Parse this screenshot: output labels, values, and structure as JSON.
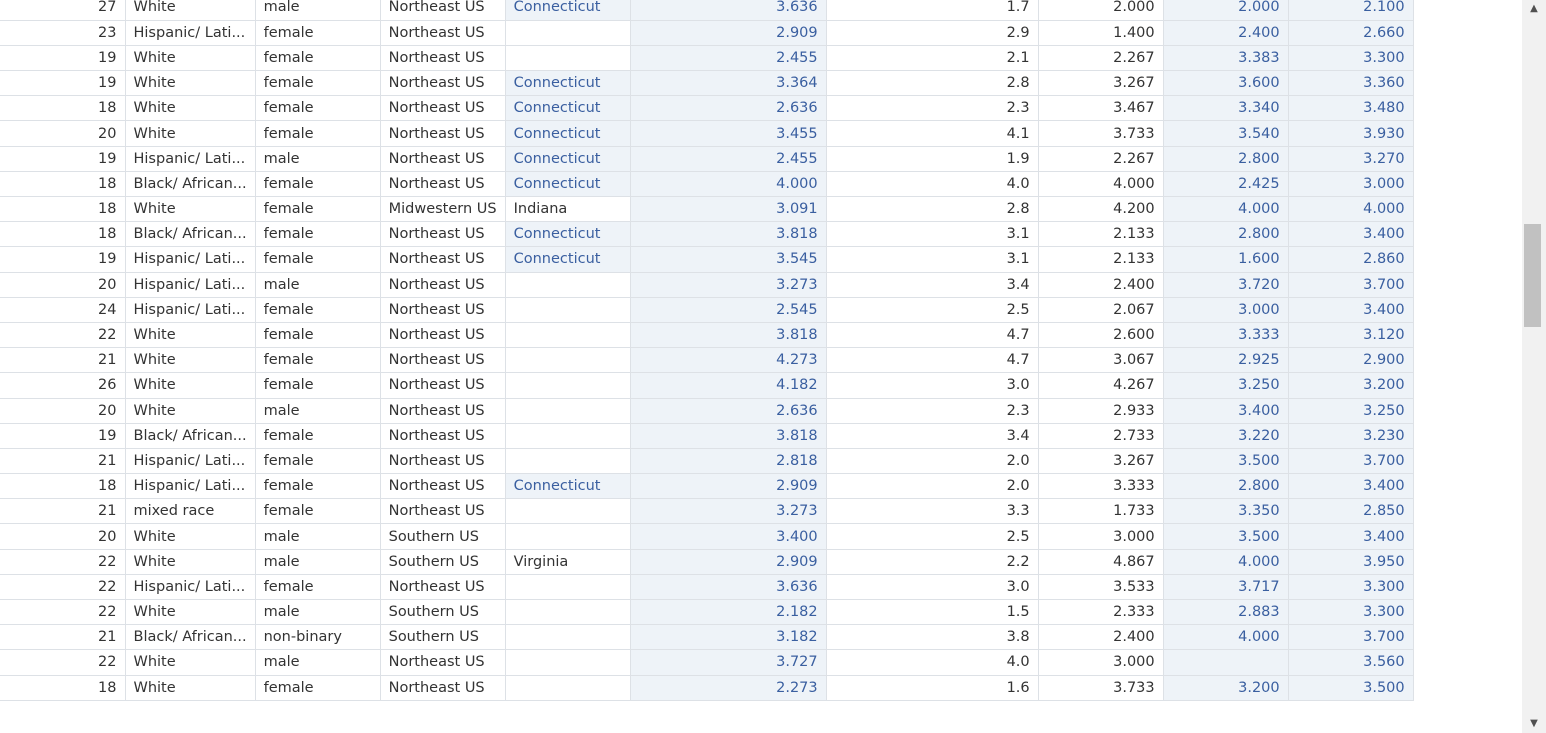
{
  "rows": [
    [
      "27",
      "White",
      "male",
      "Northeast US",
      "Connecticut",
      "3.636",
      "1.7",
      "2.000",
      "2.000",
      "2.100"
    ],
    [
      "23",
      "Hispanic/ Lati...",
      "female",
      "Northeast US",
      "",
      "2.909",
      "2.9",
      "1.400",
      "2.400",
      "2.660"
    ],
    [
      "19",
      "White",
      "female",
      "Northeast US",
      "",
      "2.455",
      "2.1",
      "2.267",
      "3.383",
      "3.300"
    ],
    [
      "19",
      "White",
      "female",
      "Northeast US",
      "Connecticut",
      "3.364",
      "2.8",
      "3.267",
      "3.600",
      "3.360"
    ],
    [
      "18",
      "White",
      "female",
      "Northeast US",
      "Connecticut",
      "2.636",
      "2.3",
      "3.467",
      "3.340",
      "3.480"
    ],
    [
      "20",
      "White",
      "female",
      "Northeast US",
      "Connecticut",
      "3.455",
      "4.1",
      "3.733",
      "3.540",
      "3.930"
    ],
    [
      "19",
      "Hispanic/ Lati...",
      "male",
      "Northeast US",
      "Connecticut",
      "2.455",
      "1.9",
      "2.267",
      "2.800",
      "3.270"
    ],
    [
      "18",
      "Black/ African...",
      "female",
      "Northeast US",
      "Connecticut",
      "4.000",
      "4.0",
      "4.000",
      "2.425",
      "3.000"
    ],
    [
      "18",
      "White",
      "female",
      "Midwestern US",
      "Indiana",
      "3.091",
      "2.8",
      "4.200",
      "4.000",
      "4.000"
    ],
    [
      "18",
      "Black/ African...",
      "female",
      "Northeast US",
      "Connecticut",
      "3.818",
      "3.1",
      "2.133",
      "2.800",
      "3.400"
    ],
    [
      "19",
      "Hispanic/ Lati...",
      "female",
      "Northeast US",
      "Connecticut",
      "3.545",
      "3.1",
      "2.133",
      "1.600",
      "2.860"
    ],
    [
      "20",
      "Hispanic/ Lati...",
      "male",
      "Northeast US",
      "",
      "3.273",
      "3.4",
      "2.400",
      "3.720",
      "3.700"
    ],
    [
      "24",
      "Hispanic/ Lati...",
      "female",
      "Northeast US",
      "",
      "2.545",
      "2.5",
      "2.067",
      "3.000",
      "3.400"
    ],
    [
      "22",
      "White",
      "female",
      "Northeast US",
      "",
      "3.818",
      "4.7",
      "2.600",
      "3.333",
      "3.120"
    ],
    [
      "21",
      "White",
      "female",
      "Northeast US",
      "",
      "4.273",
      "4.7",
      "3.067",
      "2.925",
      "2.900"
    ],
    [
      "26",
      "White",
      "female",
      "Northeast US",
      "",
      "4.182",
      "3.0",
      "4.267",
      "3.250",
      "3.200"
    ],
    [
      "20",
      "White",
      "male",
      "Northeast US",
      "",
      "2.636",
      "2.3",
      "2.933",
      "3.400",
      "3.250"
    ],
    [
      "19",
      "Black/ African...",
      "female",
      "Northeast US",
      "",
      "3.818",
      "3.4",
      "2.733",
      "3.220",
      "3.230"
    ],
    [
      "21",
      "Hispanic/ Lati...",
      "female",
      "Northeast US",
      "",
      "2.818",
      "2.0",
      "3.267",
      "3.500",
      "3.700"
    ],
    [
      "18",
      "Hispanic/ Lati...",
      "female",
      "Northeast US",
      "Connecticut",
      "2.909",
      "2.0",
      "3.333",
      "2.800",
      "3.400"
    ],
    [
      "21",
      "mixed race",
      "female",
      "Northeast US",
      "",
      "3.273",
      "3.3",
      "1.733",
      "3.350",
      "2.850"
    ],
    [
      "20",
      "White",
      "male",
      "Southern US",
      "",
      "3.400",
      "2.5",
      "3.000",
      "3.500",
      "3.400"
    ],
    [
      "22",
      "White",
      "male",
      "Southern US",
      "Virginia",
      "2.909",
      "2.2",
      "4.867",
      "4.000",
      "3.950"
    ],
    [
      "22",
      "Hispanic/ Lati...",
      "female",
      "Northeast US",
      "",
      "3.636",
      "3.0",
      "3.533",
      "3.717",
      "3.300"
    ],
    [
      "22",
      "White",
      "male",
      "Southern US",
      "",
      "2.182",
      "1.5",
      "2.333",
      "2.883",
      "3.300"
    ],
    [
      "21",
      "Black/ African...",
      "non-binary",
      "Southern US",
      "",
      "3.182",
      "3.8",
      "2.400",
      "4.000",
      "3.700"
    ],
    [
      "22",
      "White",
      "male",
      "Northeast US",
      "",
      "3.727",
      "4.0",
      "3.000",
      "",
      "3.560"
    ],
    [
      "18",
      "White",
      "female",
      "Northeast US",
      "",
      "2.273",
      "1.6",
      "3.733",
      "3.200",
      "3.500"
    ]
  ],
  "scrollbar": {
    "up_glyph": "▲",
    "down_glyph": "▼"
  }
}
